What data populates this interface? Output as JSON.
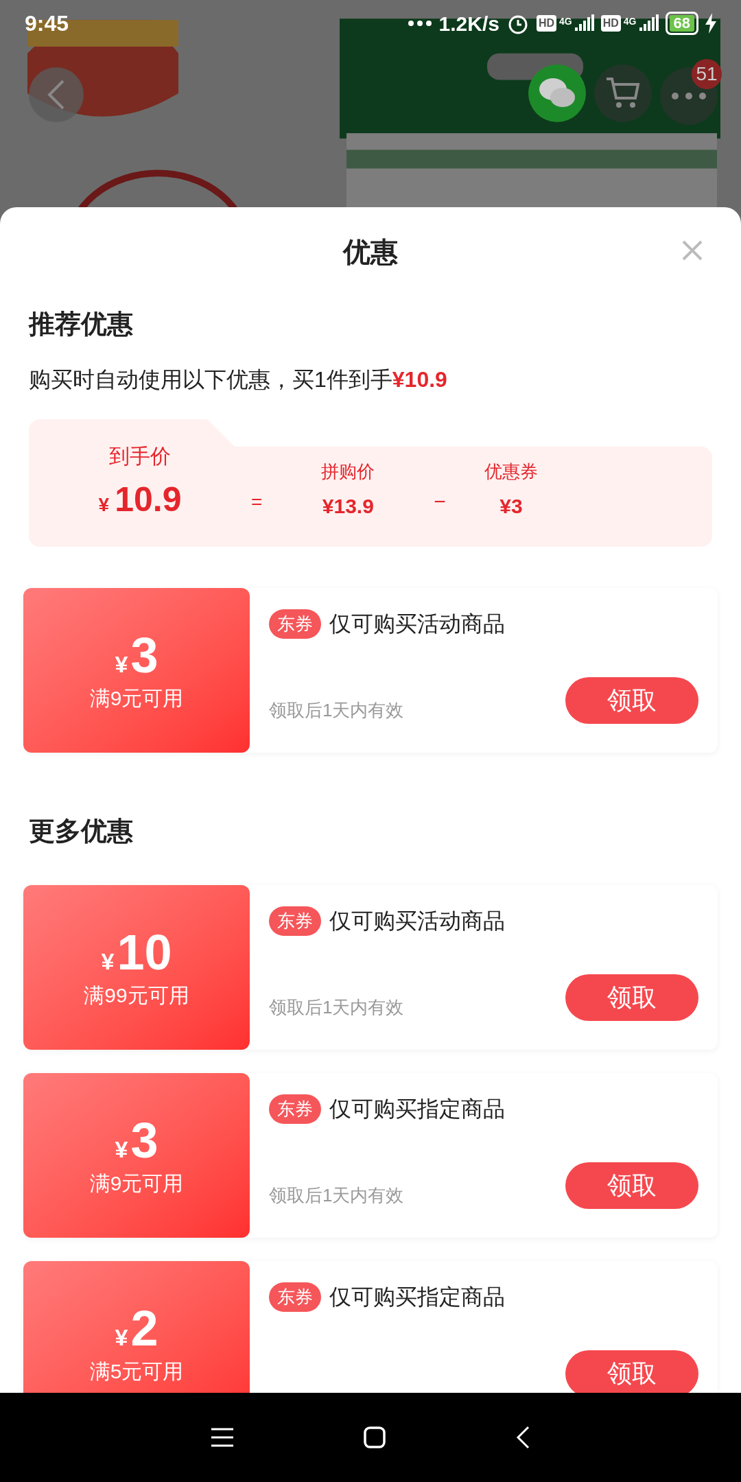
{
  "status_bar": {
    "time": "9:45",
    "speed": "1.2K/s",
    "hd_labels": [
      "HD",
      "HD"
    ],
    "network_labels": [
      "4G",
      "4G"
    ],
    "battery": "68"
  },
  "top_bar": {
    "more_badge": "51"
  },
  "sheet": {
    "title": "优惠",
    "recommended": {
      "heading": "推荐优惠",
      "summary": "购买时自动使用以下优惠，买1件到手",
      "summary_price": "¥10.9",
      "price_box": {
        "final_label": "到手价",
        "final_currency": "¥",
        "final_amount": "10.9",
        "equals": "=",
        "group_label": "拼购价",
        "group_price": "¥13.9",
        "minus": "−",
        "coupon_label": "优惠券",
        "coupon_price": "¥3"
      },
      "coupons": [
        {
          "currency": "¥",
          "amount": "3",
          "condition": "满9元可用",
          "tag": "东券",
          "description": "仅可购买活动商品",
          "validity": "领取后1天内有效",
          "button": "领取"
        }
      ]
    },
    "more": {
      "heading": "更多优惠",
      "coupons": [
        {
          "currency": "¥",
          "amount": "10",
          "condition": "满99元可用",
          "tag": "东券",
          "description": "仅可购买活动商品",
          "validity": "领取后1天内有效",
          "button": "领取"
        },
        {
          "currency": "¥",
          "amount": "3",
          "condition": "满9元可用",
          "tag": "东券",
          "description": "仅可购买指定商品",
          "validity": "领取后1天内有效",
          "button": "领取"
        },
        {
          "currency": "¥",
          "amount": "2",
          "condition": "满5元可用",
          "tag": "东券",
          "description": "仅可购买指定商品",
          "button": "领取"
        }
      ]
    }
  }
}
